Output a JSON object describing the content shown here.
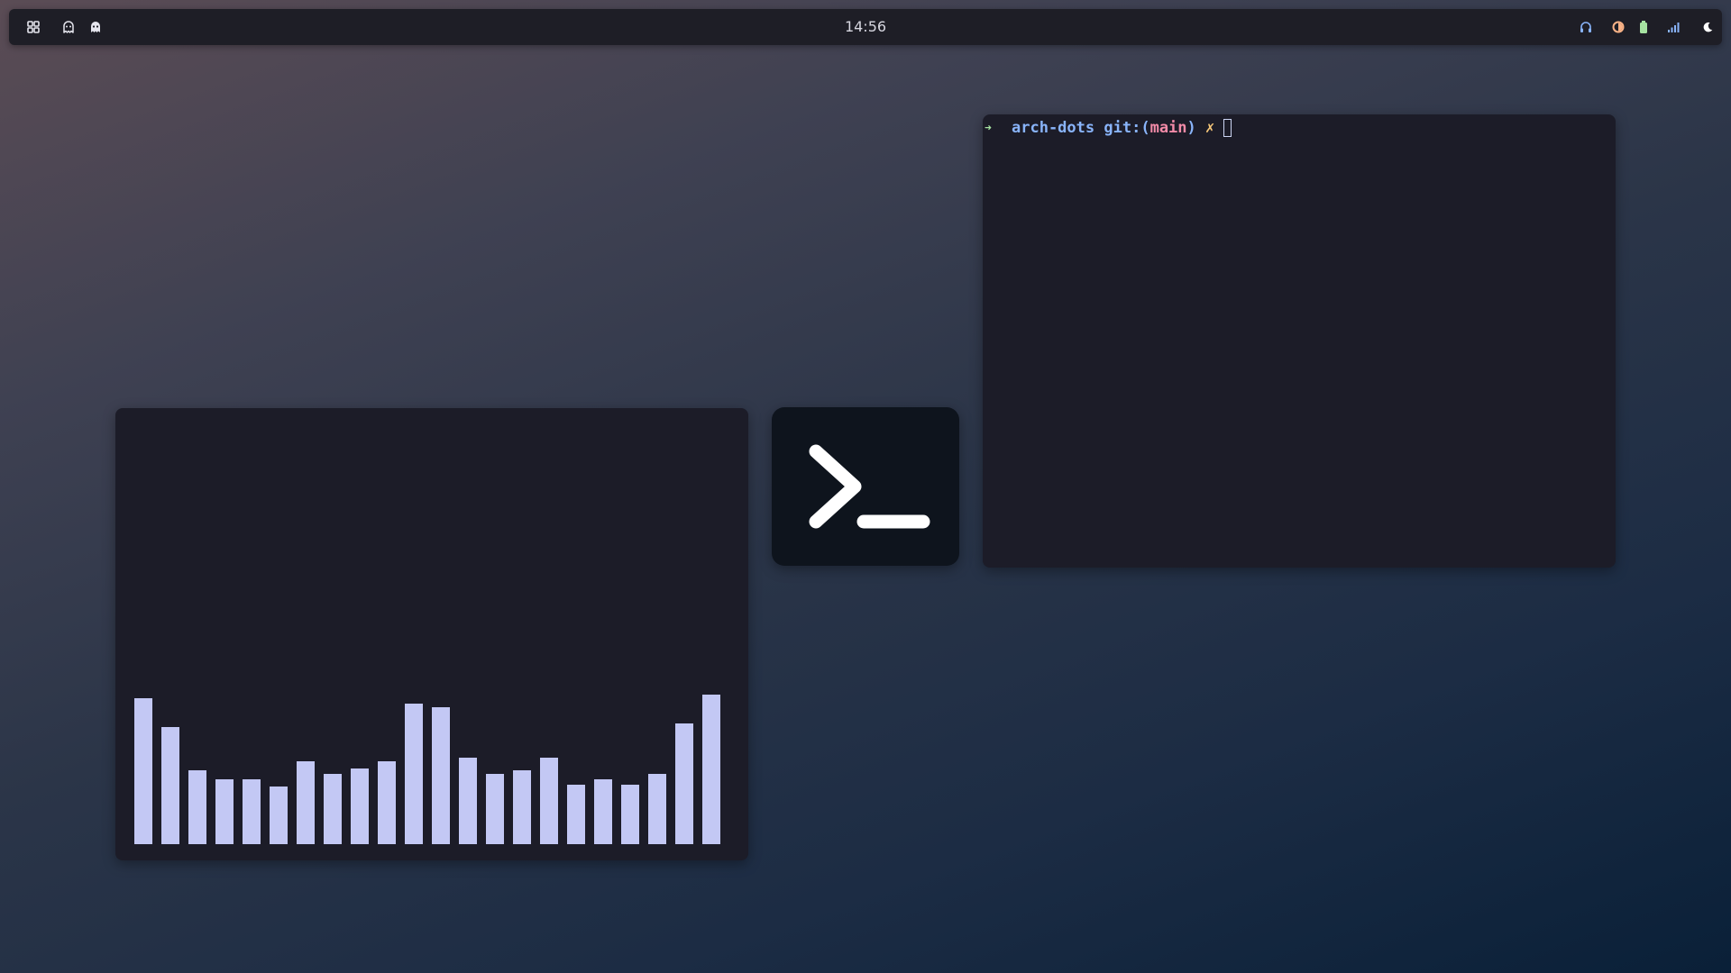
{
  "topbar": {
    "left_icons": [
      "apps-grid-icon",
      "ghost-outline-icon",
      "ghost-filled-icon"
    ],
    "clock": "14:56",
    "right_icons": [
      "headphones-icon",
      "brightness-icon",
      "battery-icon",
      "signal-icon",
      "night-mode-icon"
    ],
    "colors": {
      "headphones": "#89b4fa",
      "brightness": "#fab387",
      "battery": "#a6e3a1",
      "signal": "#89b4fa",
      "night": "#ffffff"
    }
  },
  "visualizer": {
    "bar_color": "#c3c8f4",
    "levels": [
      0.81,
      0.65,
      0.41,
      0.36,
      0.36,
      0.32,
      0.46,
      0.39,
      0.42,
      0.46,
      0.78,
      0.76,
      0.48,
      0.39,
      0.41,
      0.48,
      0.33,
      0.36,
      0.33,
      0.39,
      0.67,
      0.83
    ]
  },
  "app_icon": {
    "name": "terminal-app-icon",
    "background": "#0e141d"
  },
  "terminal": {
    "arrow": "➜",
    "dir": "arch-dots",
    "git_label": "git:",
    "paren_open": "(",
    "branch": "main",
    "paren_close": ")",
    "dirty_mark": "✗"
  }
}
